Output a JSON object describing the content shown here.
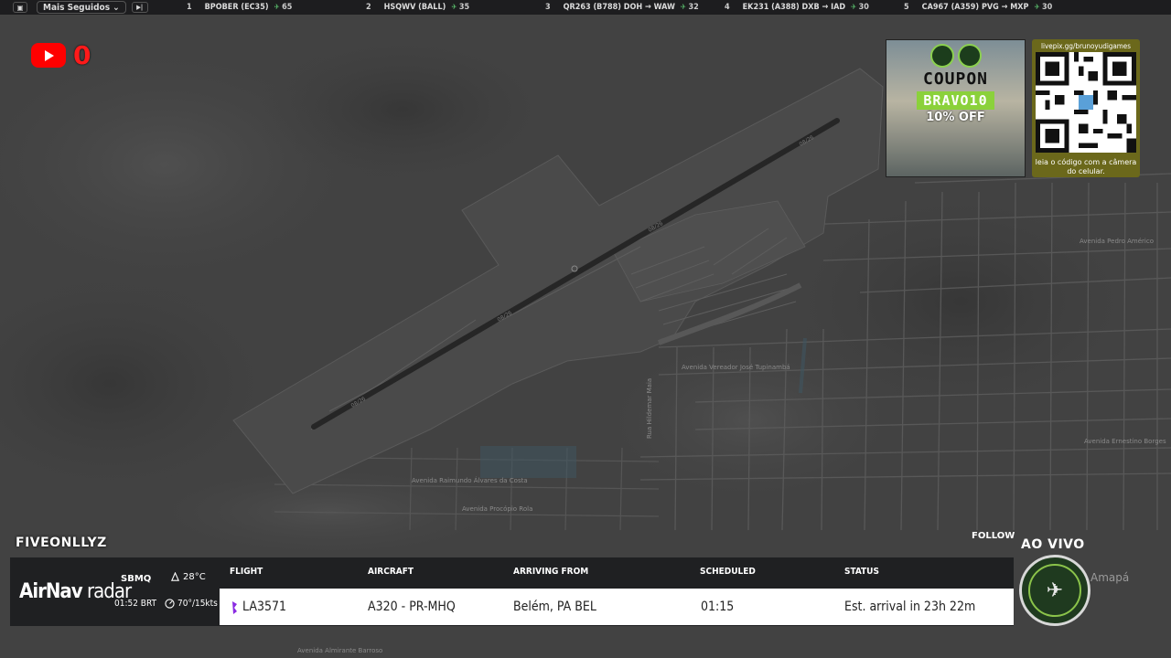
{
  "topbar": {
    "filter_label": "Mais Seguidos",
    "items": [
      {
        "rank": "1",
        "flight": "BPOBER (EC35)",
        "count": "65"
      },
      {
        "rank": "2",
        "flight": "HSQWV (BALL)",
        "count": "35"
      },
      {
        "rank": "3",
        "flight": "QR263 (B788) DOH → WAW",
        "count": "32"
      },
      {
        "rank": "4",
        "flight": "EK231 (A388) DXB → IAD",
        "count": "30"
      },
      {
        "rank": "5",
        "flight": "CA967 (A359) PVG → MXP",
        "count": "30"
      }
    ]
  },
  "youtube": {
    "count": "0"
  },
  "coupon": {
    "title": "COUPON",
    "code": "BRAVO10",
    "discount": "10% OFF"
  },
  "qr": {
    "url": "livepix.gg/brunoyudigames",
    "caption": "leia o código com a câmera do celular."
  },
  "stream": {
    "username": "FIVEONLLYZ",
    "follow_label": "FOLLOW",
    "live_label": "AO VIVO"
  },
  "airport": {
    "brand_a": "AirNav",
    "brand_b": "radar",
    "icao": "SBMQ",
    "local_time": "01:52 BRT",
    "temperature": "28°C",
    "wind": "70°/15kts"
  },
  "table": {
    "headers": {
      "flight": "FLIGHT",
      "aircraft": "AIRCRAFT",
      "from": "ARRIVING FROM",
      "scheduled": "SCHEDULED",
      "status": "STATUS"
    },
    "row": {
      "flight": "LA3571",
      "aircraft": "A320 - PR-MHQ",
      "from": "Belém, PA BEL",
      "scheduled": "01:15",
      "status": "Est. arrival in 23h 22m"
    }
  },
  "map": {
    "streets": [
      "Avenida Pedro Américo",
      "Avenida Vereador José Tupinambá",
      "Avenida Raimundo Álvares da Costa",
      "Avenida Procópio Rola",
      "Avenida Ernestino Borges",
      "Avenida Almirante Barroso",
      "Rua Hildemar Maia",
      "Amapá"
    ],
    "runway_labels": [
      "08/26",
      "08/26",
      "08/26",
      "08/26"
    ]
  }
}
